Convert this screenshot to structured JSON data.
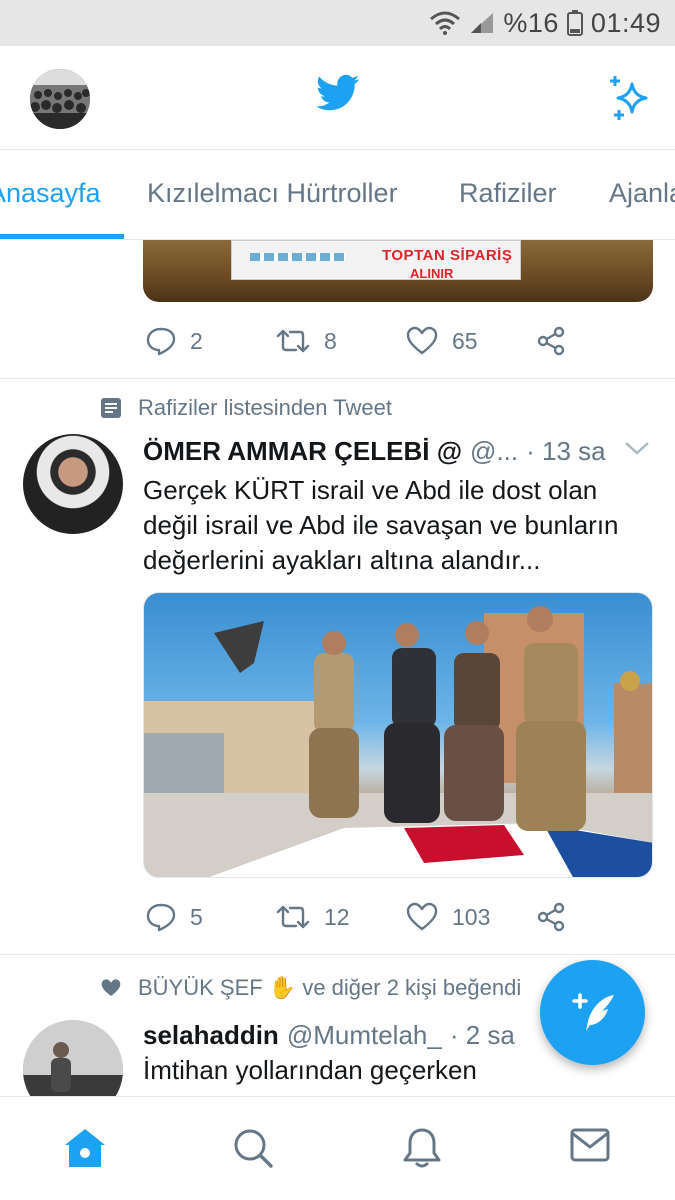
{
  "status_bar": {
    "battery_percent": "%16",
    "time": "01:49",
    "icons": [
      "wifi-icon",
      "signal-icon",
      "battery-icon"
    ]
  },
  "header": {
    "logo": "twitter-bird-icon",
    "right_icon": "sparkle-icon"
  },
  "tabs": [
    {
      "label": "Anasayfa",
      "active": true
    },
    {
      "label": "Kızılelmacı Hürtroller",
      "active": false
    },
    {
      "label": "Rafiziler",
      "active": false
    },
    {
      "label": "Ajanlar",
      "active": false
    }
  ],
  "feed": {
    "partial_tweet": {
      "image_text_1": "TOPTAN SİPARİŞ",
      "image_text_2": "ALINIR",
      "actions": {
        "replies": "2",
        "retweets": "8",
        "likes": "65"
      }
    },
    "tweet1": {
      "context": "Rafiziler listesinden Tweet",
      "name": "ÖMER AMMAR ÇELEBİ @",
      "handle": "@...",
      "time": "· 13 sa",
      "text": "Gerçek KÜRT israil ve Abd ile dost olan değil israil ve Abd ile savaşan ve bunların değerlerini ayakları altına alandır...",
      "actions": {
        "replies": "5",
        "retweets": "12",
        "likes": "103"
      }
    },
    "tweet2": {
      "context": "BÜYÜK ŞEF ✋ ve diğer 2 kişi beğendi",
      "name": "selahaddin",
      "handle": "@Mumtelah_",
      "time": "· 2 sa",
      "text": "İmtihan yollarından geçerken"
    }
  },
  "bottom_nav": [
    "home-icon",
    "search-icon",
    "notifications-icon",
    "messages-icon"
  ],
  "colors": {
    "accent": "#1da1f2",
    "secondary_text": "#657786",
    "divider": "#e1e8ed"
  }
}
